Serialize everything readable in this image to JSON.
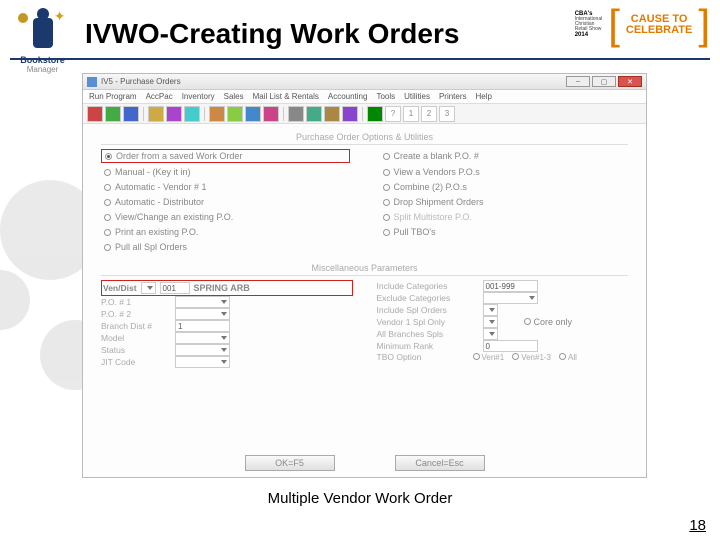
{
  "slide": {
    "title": "IVWO-Creating Work Orders",
    "caption": "Multiple Vendor Work Order",
    "page": "18"
  },
  "logoLeft": {
    "line1": "Bookstore",
    "line2": "Manager"
  },
  "logoRight": {
    "cbm_line1": "CBA's",
    "cbm_line2": "International",
    "cbm_line3": "Christian",
    "cbm_line4": "Retail Show",
    "cbm_year": "2014",
    "cause": "CAUSE TO",
    "celebrate": "CELEBRATE"
  },
  "window": {
    "title": "IV5 - Purchase Orders",
    "menus": [
      "Run Program",
      "AccPac",
      "Inventory",
      "Sales",
      "Mail List & Rentals",
      "Accounting",
      "Tools",
      "Utilities",
      "Printers",
      "Help"
    ],
    "toolbarNums": [
      "?",
      "1",
      "2",
      "3"
    ],
    "section1": "Purchase Order Options & Utilities",
    "options": [
      {
        "label": "Order from a saved Work Order",
        "sel": true,
        "hl": true
      },
      {
        "label": "Create a blank P.O. #",
        "sel": false
      },
      {
        "label": "Manual - (Key it in)",
        "sel": false
      },
      {
        "label": "View a Vendors P.O.s",
        "sel": false
      },
      {
        "label": "Automatic - Vendor # 1",
        "sel": false
      },
      {
        "label": "Combine (2) P.O.s",
        "sel": false
      },
      {
        "label": "Automatic - Distributor",
        "sel": false
      },
      {
        "label": "Drop Shipment Orders",
        "sel": false
      },
      {
        "label": "View/Change an existing P.O.",
        "sel": false
      },
      {
        "label": "Split Multistore P.O.",
        "sel": false,
        "faded": true
      },
      {
        "label": "Print an existing P.O.",
        "sel": false
      },
      {
        "label": "Pull TBO's",
        "sel": false
      },
      {
        "label": "Pull all Spl Orders",
        "sel": false
      },
      {
        "label": "",
        "sel": false,
        "empty": true
      }
    ],
    "section2": "Miscellaneous Parameters",
    "vendist": {
      "label": "Ven/Dist",
      "code": "001",
      "name": "SPRING ARB"
    },
    "leftParams": [
      {
        "label": "P.O. # 1"
      },
      {
        "label": "P.O. # 2"
      },
      {
        "label": "Branch Dist #",
        "val": "1"
      },
      {
        "label": "Model"
      },
      {
        "label": "Status"
      },
      {
        "label": "JIT Code"
      }
    ],
    "rightParams": [
      {
        "label": "Include Categories",
        "val": "001-999"
      },
      {
        "label": "Exclude Categories"
      },
      {
        "label": "Include Spl Orders",
        "short": true
      },
      {
        "label": "Vendor 1 Spl Only",
        "short": true,
        "extra": "Core only"
      },
      {
        "label": "All Branches Spls",
        "short": true
      },
      {
        "label": "Minimum Rank",
        "val": "0"
      }
    ],
    "tbo": {
      "label": "TBO Option",
      "opts": [
        "Ven#1",
        "Ven#1-3",
        "All"
      ]
    },
    "buttons": {
      "ok": "OK=F5",
      "cancel": "Cancel=Esc"
    }
  }
}
